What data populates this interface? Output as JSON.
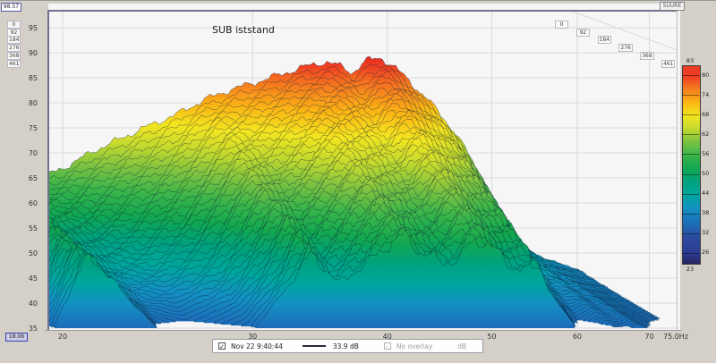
{
  "title": "SUB iststand",
  "window": {
    "db_axis_max_box": "98.57",
    "freq_axis_min_box": "18.06",
    "corner_box": "SUURE"
  },
  "legend_bar": {
    "check_glyph": "✓",
    "measurement_label": "Nov 22 9:40:44",
    "level_label": "33.9 dB",
    "overlay_label": "No overlay",
    "unit_label": "dB"
  },
  "color_scale": {
    "top_label": 83,
    "bottom_label": 23,
    "tick_labels": [
      80,
      74,
      68,
      62,
      56,
      50,
      44,
      38,
      32,
      26
    ]
  },
  "colors": {
    "frame": "#70708f",
    "grid": "#d9d9d9",
    "plot_bg": "#f6f6f6",
    "window_bg": "#d4d0c8",
    "slice_stroke": "rgba(8,28,48,0.55)"
  },
  "chart_data": {
    "type": "waterfall",
    "title": "SUB iststand",
    "x_axis": {
      "unit": "Hz",
      "scale": "log",
      "min": 18.06,
      "max": 75.0,
      "ticks": [
        20,
        30,
        40,
        50,
        60,
        70
      ],
      "end_label": "75.0Hz"
    },
    "y_axis": {
      "unit": "dB",
      "min": 35,
      "max": 98.57,
      "ticks": [
        95,
        90,
        85,
        80,
        75,
        70,
        65,
        60,
        55,
        50,
        45,
        40,
        35
      ]
    },
    "z_axis": {
      "unit": "ms",
      "min": 0,
      "max": 461,
      "ticks": [
        0,
        92,
        184,
        276,
        368,
        461
      ]
    },
    "slices": 46,
    "db_floor": 35,
    "base_response_db": [
      [
        16,
        45
      ],
      [
        18,
        50
      ],
      [
        20,
        55
      ],
      [
        21.5,
        58
      ],
      [
        23,
        56
      ],
      [
        25,
        59
      ],
      [
        27,
        63
      ],
      [
        30,
        67.5
      ],
      [
        32,
        70
      ],
      [
        34,
        73
      ],
      [
        36,
        75
      ],
      [
        38,
        76.5
      ],
      [
        40,
        78
      ],
      [
        42,
        79.5
      ],
      [
        44,
        80.5
      ],
      [
        45.3,
        79.8
      ],
      [
        46.6,
        78.3
      ],
      [
        48,
        80.8
      ],
      [
        49.5,
        81.3
      ],
      [
        51,
        79.5
      ],
      [
        53,
        76
      ],
      [
        55,
        72.5
      ],
      [
        57,
        68.5
      ],
      [
        59,
        64
      ],
      [
        61,
        58.5
      ],
      [
        63,
        52.5
      ],
      [
        65,
        47
      ],
      [
        67,
        43.5
      ],
      [
        70,
        41.5
      ],
      [
        73,
        40
      ],
      [
        76,
        39
      ]
    ],
    "total_decay_db": [
      [
        16,
        26
      ],
      [
        19,
        24
      ],
      [
        21,
        8
      ],
      [
        23,
        15
      ],
      [
        25,
        26
      ],
      [
        27,
        33
      ],
      [
        30,
        33
      ],
      [
        32,
        28
      ],
      [
        34,
        23
      ],
      [
        36,
        31
      ],
      [
        38,
        29
      ],
      [
        40,
        26.5
      ],
      [
        41.5,
        25.5
      ],
      [
        43,
        30
      ],
      [
        45,
        32
      ],
      [
        47,
        29
      ],
      [
        48.5,
        28.5
      ],
      [
        50,
        29.5
      ],
      [
        52,
        30.5
      ],
      [
        54,
        27.5
      ],
      [
        55.5,
        24.5
      ],
      [
        57,
        27.5
      ],
      [
        59,
        27
      ],
      [
        61,
        25.5
      ],
      [
        63,
        21
      ],
      [
        65,
        12
      ],
      [
        68,
        7
      ],
      [
        72,
        6
      ],
      [
        76,
        5
      ]
    ],
    "color_stops": [
      {
        "db": 84,
        "color": "#d8101f"
      },
      {
        "db": 80,
        "color": "#ee3b23"
      },
      {
        "db": 76,
        "color": "#f57d1f"
      },
      {
        "db": 72,
        "color": "#fbb615"
      },
      {
        "db": 68,
        "color": "#f3e520"
      },
      {
        "db": 64,
        "color": "#c3d92e"
      },
      {
        "db": 60,
        "color": "#7cc241"
      },
      {
        "db": 56,
        "color": "#3ab54a"
      },
      {
        "db": 52,
        "color": "#12a750"
      },
      {
        "db": 48,
        "color": "#00a17e"
      },
      {
        "db": 44,
        "color": "#00a69d"
      },
      {
        "db": 40,
        "color": "#1391c2"
      },
      {
        "db": 36,
        "color": "#1b74bc"
      },
      {
        "db": 31,
        "color": "#2c4ba0"
      },
      {
        "db": 26,
        "color": "#2c3a92"
      },
      {
        "db": 23,
        "color": "#282560"
      }
    ],
    "legend_db_max": 83,
    "legend_db_min": 23
  }
}
